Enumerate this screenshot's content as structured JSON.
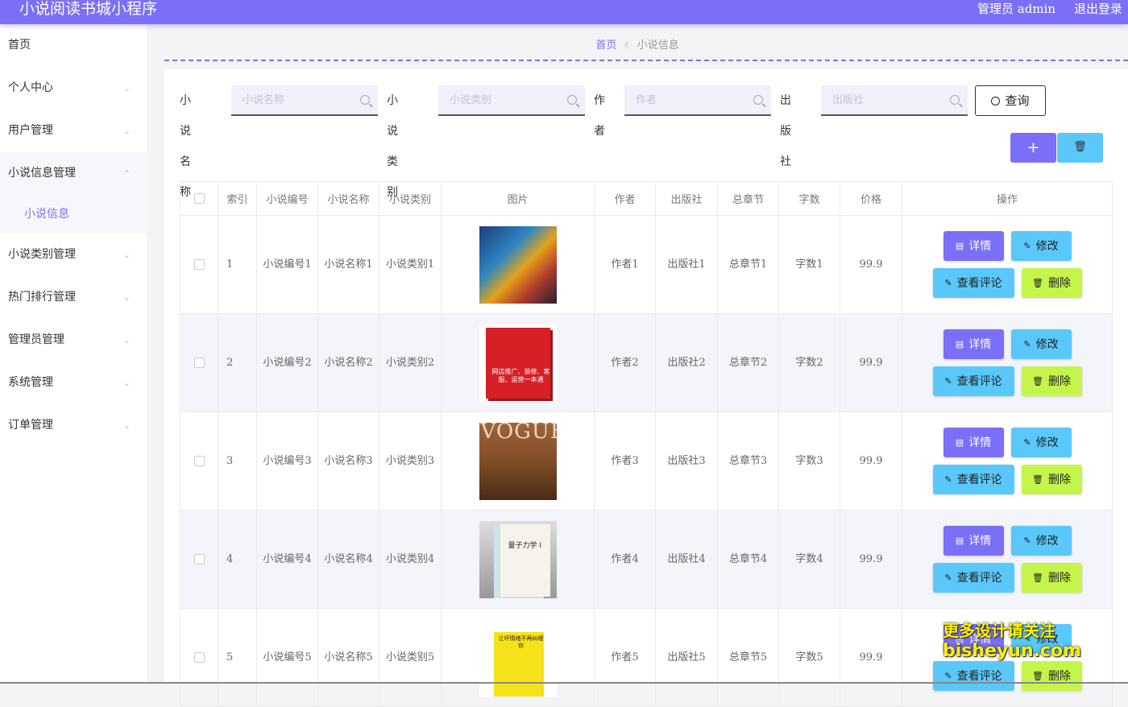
{
  "app": {
    "title": "小说阅读书城小程序",
    "user": "管理员 admin",
    "logout": "退出登录"
  },
  "sidebar": {
    "items": [
      {
        "label": "首页",
        "chevron": ""
      },
      {
        "label": "个人中心",
        "chevron": "⌄"
      },
      {
        "label": "用户管理",
        "chevron": "⌄"
      },
      {
        "label": "小说信息管理",
        "chevron": "⌃"
      },
      {
        "label": "小说类别管理",
        "chevron": "⌄"
      },
      {
        "label": "热门排行管理",
        "chevron": "⌄"
      },
      {
        "label": "管理员管理",
        "chevron": "⌄"
      },
      {
        "label": "系统管理",
        "chevron": "⌄"
      },
      {
        "label": "订单管理",
        "chevron": "⌄"
      }
    ],
    "submenu": {
      "label": "小说信息"
    }
  },
  "breadcrumb": {
    "home": "首页",
    "sep": "✌",
    "current": "小说信息"
  },
  "search": {
    "name_label": "小说名称",
    "name_placeholder": "小说名称",
    "category_label": "小说类别",
    "category_placeholder": "小说类别",
    "author_label": "作者",
    "author_placeholder": "作者",
    "publisher_label": "出版社",
    "publisher_placeholder": "出版社",
    "query_label": "查询"
  },
  "toolbar": {
    "add_icon": "+",
    "delete_icon": "🗑"
  },
  "table": {
    "headers": [
      "索引",
      "小说编号",
      "小说名称",
      "小说类别",
      "图片",
      "作者",
      "出版社",
      "总章节",
      "字数",
      "价格",
      "操作"
    ],
    "rows": [
      {
        "index": "1",
        "code": "小说编号1",
        "name": "小说名称1",
        "category": "小说类别1",
        "author": "作者1",
        "publisher": "出版社1",
        "chapters": "总章节1",
        "words": "字数1",
        "price": "99.9"
      },
      {
        "index": "2",
        "code": "小说编号2",
        "name": "小说名称2",
        "category": "小说类别2",
        "author": "作者2",
        "publisher": "出版社2",
        "chapters": "总章节2",
        "words": "字数2",
        "price": "99.9"
      },
      {
        "index": "3",
        "code": "小说编号3",
        "name": "小说名称3",
        "category": "小说类别3",
        "author": "作者3",
        "publisher": "出版社3",
        "chapters": "总章节3",
        "words": "字数3",
        "price": "99.9"
      },
      {
        "index": "4",
        "code": "小说编号4",
        "name": "小说名称4",
        "category": "小说类别4",
        "author": "作者4",
        "publisher": "出版社4",
        "chapters": "总章节4",
        "words": "字数4",
        "price": "99.9"
      },
      {
        "index": "5",
        "code": "小说编号5",
        "name": "小说名称5",
        "category": "小说类别5",
        "author": "作者5",
        "publisher": "出版社5",
        "chapters": "总章节5",
        "words": "字数5",
        "price": "99.9"
      }
    ],
    "actions": {
      "detail": "详情",
      "edit": "修改",
      "review": "查看评论",
      "delete": "删除"
    },
    "covers": {
      "cover2": "网店推广、装修、客服、运营一本通",
      "cover3": "VOGUE",
      "cover4": "量子力学 I",
      "cover5": "让坏情绪不再纠缠你"
    }
  },
  "watermark": {
    "line1": "更多设计请关注",
    "line2": "bisheyun.com"
  },
  "colors": {
    "primary": "#7b6ff7",
    "info": "#5ac8fa",
    "danger_lime": "#c5f54a"
  }
}
